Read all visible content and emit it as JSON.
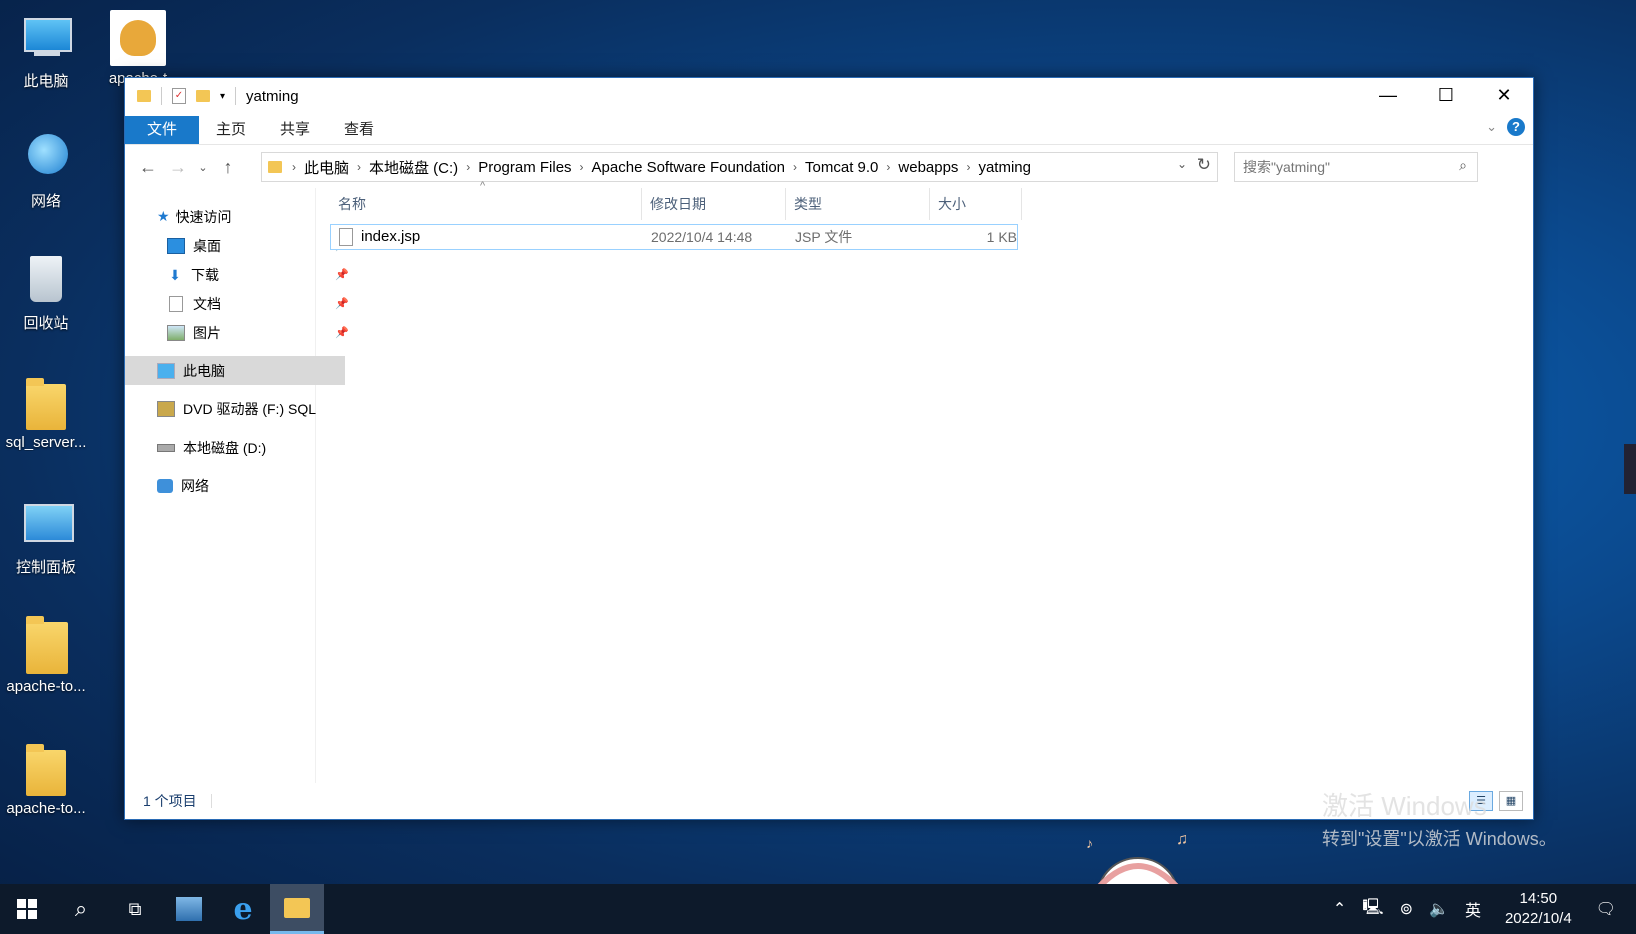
{
  "desktop": {
    "icons": [
      {
        "label": "此电脑"
      },
      {
        "label": "apache-t"
      },
      {
        "label": "网络"
      },
      {
        "label": "回收站"
      },
      {
        "label": "sql_server..."
      },
      {
        "label": "控制面板"
      },
      {
        "label": "apache-to..."
      },
      {
        "label": "apache-to..."
      }
    ]
  },
  "window": {
    "title": "yatming",
    "controls": {
      "minimize": "—",
      "maximize": "☐",
      "close": "✕"
    },
    "ribbon_tabs": [
      {
        "label": "文件",
        "active": true
      },
      {
        "label": "主页"
      },
      {
        "label": "共享"
      },
      {
        "label": "查看"
      }
    ],
    "help": "?",
    "address": {
      "crumbs": [
        "此电脑",
        "本地磁盘 (C:)",
        "Program Files",
        "Apache Software Foundation",
        "Tomcat 9.0",
        "webapps",
        "yatming"
      ]
    },
    "search": {
      "placeholder": "搜索\"yatming\""
    },
    "nav": {
      "quick_access": "快速访问",
      "items": [
        {
          "label": "桌面",
          "pinned": true
        },
        {
          "label": "下载",
          "pinned": true
        },
        {
          "label": "文档",
          "pinned": true
        },
        {
          "label": "图片",
          "pinned": true
        }
      ],
      "this_pc": "此电脑",
      "dvd": "DVD 驱动器 (F:) SQL",
      "disk_d": "本地磁盘 (D:)",
      "network": "网络"
    },
    "columns": [
      "名称",
      "修改日期",
      "类型",
      "大小"
    ],
    "files": [
      {
        "name": "index.jsp",
        "modified": "2022/10/4 14:48",
        "type": "JSP 文件",
        "size": "1 KB"
      }
    ],
    "status": "1 个项目"
  },
  "watermark": {
    "line1": "激活 Windows",
    "line2": "转到\"设置\"以激活 Windows。"
  },
  "taskbar": {
    "ime": "英",
    "time": "14:50",
    "date": "2022/10/4"
  }
}
